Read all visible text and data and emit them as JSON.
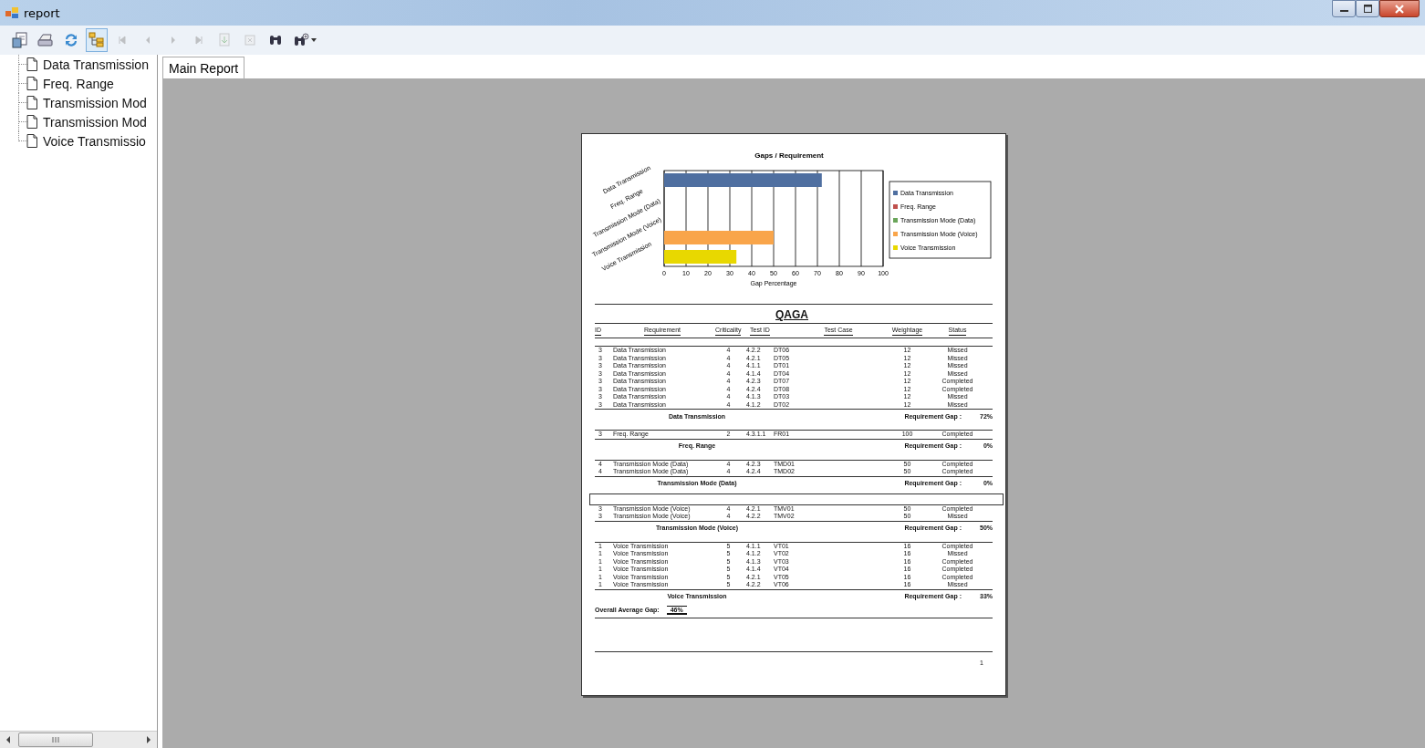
{
  "window": {
    "title": "report"
  },
  "toolbar": [
    {
      "kind": "export",
      "disabled": false,
      "pressed": false
    },
    {
      "kind": "print",
      "disabled": false,
      "pressed": false
    },
    {
      "kind": "refresh",
      "disabled": false,
      "pressed": false
    },
    {
      "kind": "group_tree",
      "disabled": false,
      "pressed": true
    },
    {
      "kind": "first",
      "disabled": true,
      "pressed": false
    },
    {
      "kind": "previous",
      "disabled": true,
      "pressed": false
    },
    {
      "kind": "next",
      "disabled": true,
      "pressed": false
    },
    {
      "kind": "last",
      "disabled": true,
      "pressed": false
    },
    {
      "kind": "goto",
      "disabled": true,
      "pressed": false
    },
    {
      "kind": "stop",
      "disabled": true,
      "pressed": false
    },
    {
      "kind": "find",
      "disabled": false,
      "pressed": false
    },
    {
      "kind": "zoom",
      "disabled": false,
      "pressed": false
    }
  ],
  "group_tree": {
    "items": [
      {
        "label": "Data Transmission"
      },
      {
        "label": "Freq. Range"
      },
      {
        "label": "Transmission Mod"
      },
      {
        "label": "Transmission Mod"
      },
      {
        "label": "Voice Transmissio"
      }
    ]
  },
  "tabs": [
    {
      "label": "Main Report",
      "selected": true
    }
  ],
  "report": {
    "chart": {
      "chart_data": {
        "type": "bar",
        "orientation": "horizontal",
        "stacked": true,
        "grid": true,
        "legend": "right",
        "title": "Gaps / Requirement",
        "xlabel": "Gap Percentage",
        "categories": [
          "Data Transmission",
          "Freq. Range",
          "Transmission Mode (Data)",
          "Transmission Mode (Voice)",
          "Voice Transmission"
        ],
        "xlim": [
          0,
          100
        ],
        "xticks": [
          0,
          10,
          20,
          30,
          40,
          50,
          60,
          70,
          80,
          90,
          100
        ],
        "series": [
          {
            "name": "Data Transmission",
            "color": "#4f6fa0",
            "values": [
              72,
              null,
              null,
              null,
              null
            ]
          },
          {
            "name": "Freq. Range",
            "color": "#c0504d",
            "values": [
              null,
              0,
              null,
              null,
              null
            ]
          },
          {
            "name": "Transmission Mode (Data)",
            "color": "#6aa55a",
            "values": [
              null,
              null,
              0,
              null,
              null
            ]
          },
          {
            "name": "Transmission Mode (Voice)",
            "color": "#f9a54a",
            "values": [
              null,
              null,
              null,
              50,
              null
            ]
          },
          {
            "name": "Voice Transmission",
            "color": "#e8d800",
            "values": [
              null,
              null,
              null,
              null,
              33
            ]
          }
        ]
      }
    },
    "title": "QAGA",
    "columns": [
      "ID",
      "Requirement",
      "Criticality",
      "Test ID",
      "Test Case",
      "Weightage",
      "Status"
    ],
    "groups": [
      {
        "blank_header": false,
        "rows": [
          [
            "3",
            "Data Transmission",
            "4",
            "4.2.2",
            "DT06",
            "12",
            "Missed"
          ],
          [
            "3",
            "Data Transmission",
            "4",
            "4.2.1",
            "DT05",
            "12",
            "Missed"
          ],
          [
            "3",
            "Data Transmission",
            "4",
            "4.1.1",
            "DT01",
            "12",
            "Missed"
          ],
          [
            "3",
            "Data Transmission",
            "4",
            "4.1.4",
            "DT04",
            "12",
            "Missed"
          ],
          [
            "3",
            "Data Transmission",
            "4",
            "4.2.3",
            "DT07",
            "12",
            "Completed"
          ],
          [
            "3",
            "Data Transmission",
            "4",
            "4.2.4",
            "DT08",
            "12",
            "Completed"
          ],
          [
            "3",
            "Data Transmission",
            "4",
            "4.1.3",
            "DT03",
            "12",
            "Missed"
          ],
          [
            "3",
            "Data Transmission",
            "4",
            "4.1.2",
            "DT02",
            "12",
            "Missed"
          ]
        ],
        "name": "Data Transmission",
        "gap_label": "Requirement Gap :",
        "gap": "72%"
      },
      {
        "blank_header": false,
        "rows": [
          [
            "3",
            "Freq. Range",
            "2",
            "4.3.1.1",
            "FR01",
            "100",
            "Completed"
          ]
        ],
        "name": "Freq. Range",
        "gap_label": "Requirement Gap :",
        "gap": "0%"
      },
      {
        "blank_header": false,
        "rows": [
          [
            "4",
            "Transmission Mode (Data)",
            "4",
            "4.2.3",
            "TMD01",
            "50",
            "Completed"
          ],
          [
            "4",
            "Transmission Mode (Data)",
            "4",
            "4.2.4",
            "TMD02",
            "50",
            "Completed"
          ]
        ],
        "name": "Transmission Mode (Data)",
        "gap_label": "Requirement Gap :",
        "gap": "0%"
      },
      {
        "blank_header": true,
        "rows": [
          [
            "3",
            "Transmission Mode (Voice)",
            "4",
            "4.2.1",
            "TMV01",
            "50",
            "Completed"
          ],
          [
            "3",
            "Transmission Mode (Voice)",
            "4",
            "4.2.2",
            "TMV02",
            "50",
            "Missed"
          ]
        ],
        "name": "Transmission Mode (Voice)",
        "gap_label": "Requirement Gap :",
        "gap": "50%"
      },
      {
        "blank_header": false,
        "rows": [
          [
            "1",
            "Voice Transmission",
            "5",
            "4.1.1",
            "VT01",
            "16",
            "Completed"
          ],
          [
            "1",
            "Voice Transmission",
            "5",
            "4.1.2",
            "VT02",
            "16",
            "Missed"
          ],
          [
            "1",
            "Voice Transmission",
            "5",
            "4.1.3",
            "VT03",
            "16",
            "Completed"
          ],
          [
            "1",
            "Voice Transmission",
            "5",
            "4.1.4",
            "VT04",
            "16",
            "Completed"
          ],
          [
            "1",
            "Voice Transmission",
            "5",
            "4.2.1",
            "VT05",
            "16",
            "Completed"
          ],
          [
            "1",
            "Voice Transmission",
            "5",
            "4.2.2",
            "VT06",
            "16",
            "Missed"
          ]
        ],
        "name": "Voice Transmission",
        "gap_label": "Requirement Gap :",
        "gap": "33%"
      }
    ],
    "overall": {
      "label": "Overall Average Gap:",
      "value": "46%"
    },
    "page_number": "1"
  }
}
